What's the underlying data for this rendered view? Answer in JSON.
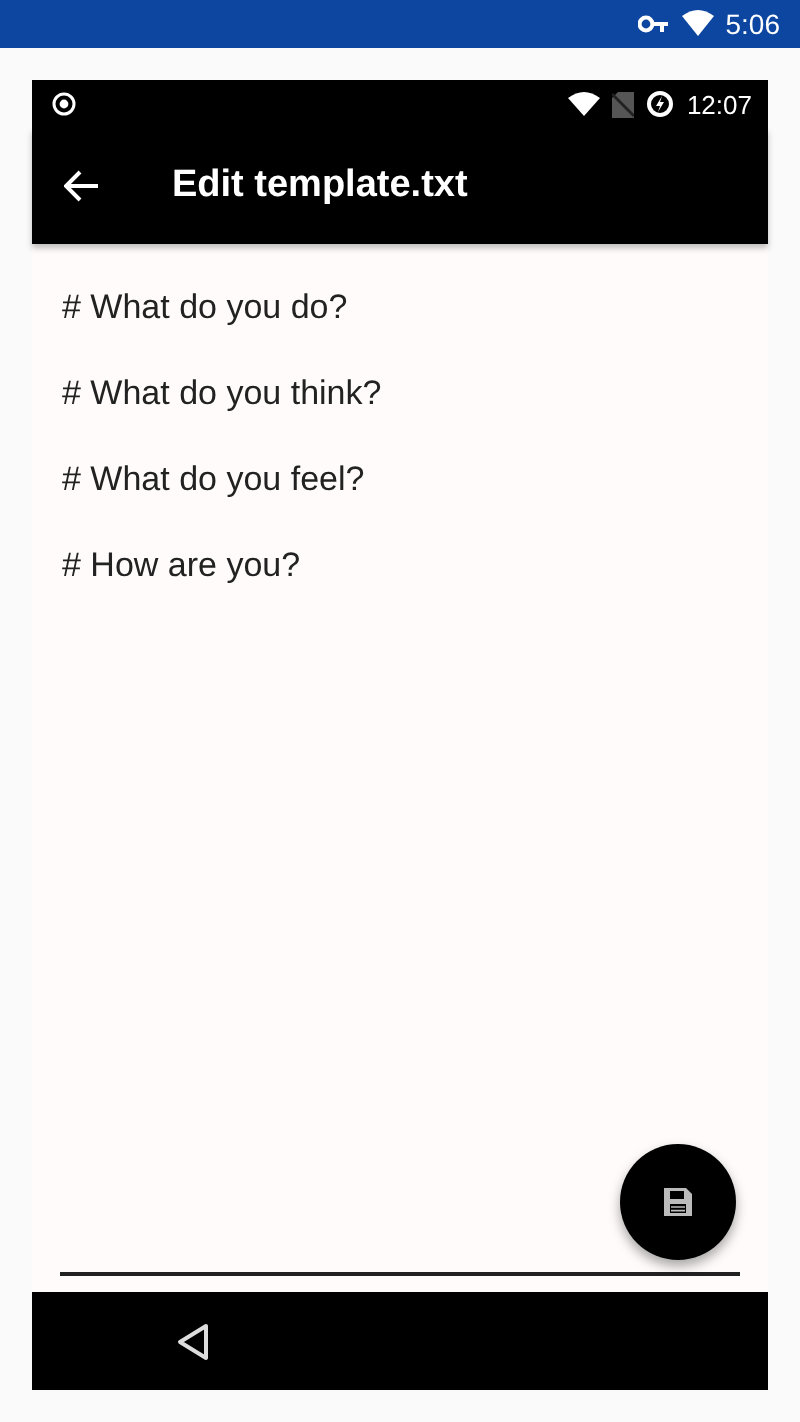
{
  "device_status_bar": {
    "time": "5:06"
  },
  "app_status_bar": {
    "time": "12:07"
  },
  "app_bar": {
    "title": "Edit template.txt"
  },
  "editor": {
    "lines": [
      "# What do you do?",
      "# What do you think?",
      "# What do you feel?",
      "# How are you?"
    ]
  }
}
